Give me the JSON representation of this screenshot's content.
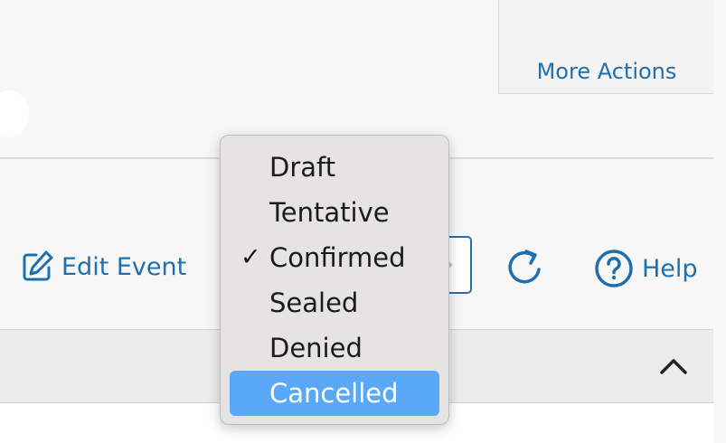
{
  "top_panel": {
    "more_actions_label": "More Actions"
  },
  "toolbar": {
    "edit_event_label": "Edit Event",
    "help_label": "Help",
    "refresh_icon": "refresh-icon",
    "edit_icon": "edit-icon",
    "help_icon": "help-circle-icon"
  },
  "status_dropdown": {
    "options": [
      "Draft",
      "Tentative",
      "Confirmed",
      "Sealed",
      "Denied",
      "Cancelled"
    ],
    "checked": "Confirmed",
    "highlighted": "Cancelled",
    "check_glyph": "✓"
  },
  "colors": {
    "link": "#1f6fae",
    "highlight": "#5aa8f8",
    "menu_bg": "#e5e4e2"
  }
}
